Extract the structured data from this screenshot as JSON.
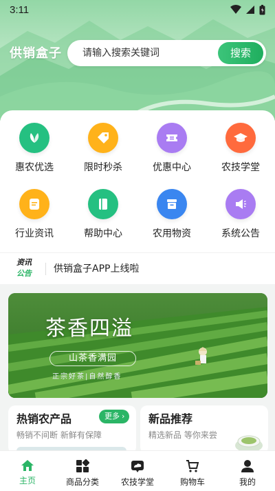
{
  "status": {
    "time": "3:11"
  },
  "header": {
    "brand": "供销盒子",
    "search": {
      "placeholder": "请输入搜索关键词",
      "button": "搜索"
    }
  },
  "categories": [
    {
      "label": "惠农优选",
      "color": "#25c081",
      "icon": "leaf-icon"
    },
    {
      "label": "限时秒杀",
      "color": "#ffb21a",
      "icon": "tag-icon"
    },
    {
      "label": "优惠中心",
      "color": "#a97cf2",
      "icon": "ticket-icon"
    },
    {
      "label": "农技学堂",
      "color": "#ff6a3d",
      "icon": "graduation-cap-icon"
    },
    {
      "label": "行业资讯",
      "color": "#ffb21a",
      "icon": "document-icon"
    },
    {
      "label": "帮助中心",
      "color": "#25c081",
      "icon": "book-icon"
    },
    {
      "label": "农用物资",
      "color": "#3a86f0",
      "icon": "box-icon"
    },
    {
      "label": "系统公告",
      "color": "#a97cf2",
      "icon": "megaphone-icon"
    }
  ],
  "notice": {
    "tag_top": "资讯",
    "tag_bottom": "公告",
    "text": "供销盒子APP上线啦"
  },
  "banner": {
    "title": "茶香四溢",
    "subtitle": "山茶香满园",
    "tagline": "正宗好茶|自然醇香"
  },
  "promos": {
    "left": {
      "title": "热销农产品",
      "subtitle": "畅销不间断 新鲜有保障",
      "more": "更多"
    },
    "right": {
      "title": "新品推荐",
      "subtitle": "精选新品 等你来尝"
    }
  },
  "tabbar": [
    {
      "label": "主页",
      "active": true,
      "icon": "home-icon"
    },
    {
      "label": "商品分类",
      "active": false,
      "icon": "grid-icon"
    },
    {
      "label": "农技学堂",
      "active": false,
      "icon": "cloud-chat-icon"
    },
    {
      "label": "购物车",
      "active": false,
      "icon": "cart-icon"
    },
    {
      "label": "我的",
      "active": false,
      "icon": "user-icon"
    }
  ],
  "colors": {
    "accent": "#2bb566"
  }
}
